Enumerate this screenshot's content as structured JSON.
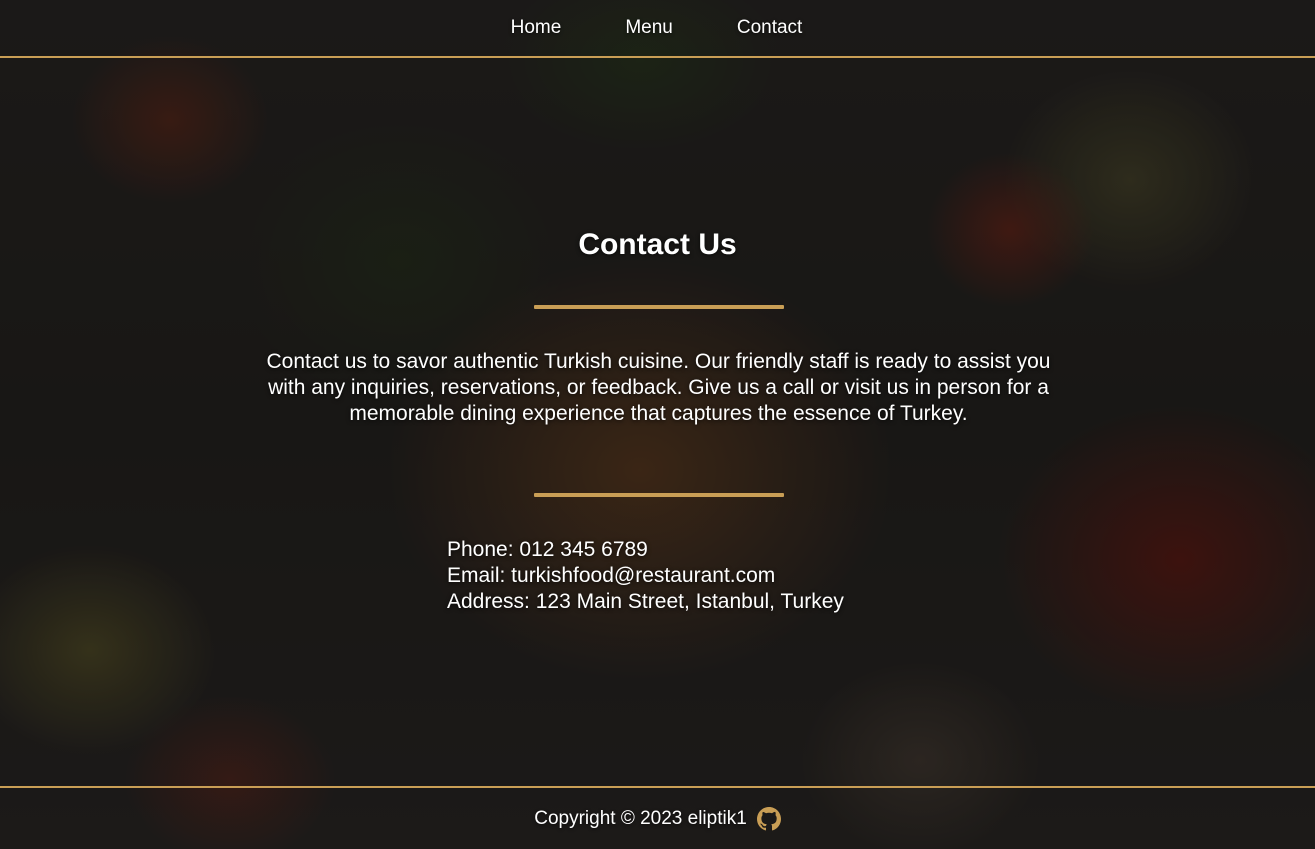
{
  "nav": {
    "items": [
      {
        "label": "Home"
      },
      {
        "label": "Menu"
      },
      {
        "label": "Contact"
      }
    ]
  },
  "main": {
    "title": "Contact Us",
    "intro": "Contact us to savor authentic Turkish cuisine. Our friendly staff is ready to assist you with any inquiries, reservations, or feedback. Give us a call or visit us in person for a memorable dining experience that captures the essence of Turkey.",
    "contact": {
      "phone": "Phone: 012 345 6789",
      "email": "Email: turkishfood@restaurant.com",
      "address": "Address: 123 Main Street, Istanbul, Turkey"
    }
  },
  "footer": {
    "copyright": "Copyright © 2023 eliptik1",
    "icon": "github-icon"
  },
  "colors": {
    "accent": "#c99e55",
    "text": "#ffffff"
  }
}
